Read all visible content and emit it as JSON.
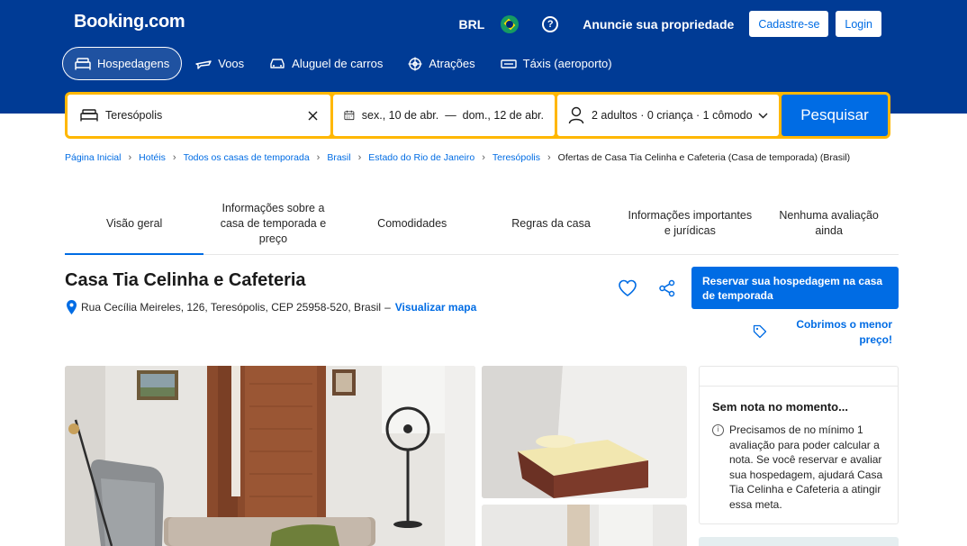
{
  "header": {
    "logo": "Booking.com",
    "currency": "BRL",
    "list_property": "Anuncie sua propriedade",
    "register": "Cadastre-se",
    "login": "Login",
    "flag_icon": "brazil-flag-icon",
    "help_icon": "help-icon"
  },
  "nav": {
    "items": [
      {
        "label": "Hospedagens",
        "icon": "bed-icon",
        "active": true
      },
      {
        "label": "Voos",
        "icon": "plane-icon"
      },
      {
        "label": "Aluguel de carros",
        "icon": "car-icon"
      },
      {
        "label": "Atrações",
        "icon": "attractions-icon"
      },
      {
        "label": "Táxis (aeroporto)",
        "icon": "taxi-icon"
      }
    ]
  },
  "search": {
    "destination": "Teresópolis",
    "dates": "sex., 10 de abr.  —  dom., 12 de abr.",
    "guests": "2 adultos · 0 criança · 1 cômodo",
    "button": "Pesquisar"
  },
  "breadcrumb": [
    "Página Inicial",
    "Hotéis",
    "Todos os casas de temporada",
    "Brasil",
    "Estado do Rio de Janeiro",
    "Teresópolis"
  ],
  "breadcrumb_current": "Ofertas de Casa Tia Celinha e Cafeteria (Casa de temporada) (Brasil)",
  "tabs": [
    "Visão geral",
    "Informações sobre a casa de temporada e preço",
    "Comodidades",
    "Regras da casa",
    "Informações importantes e jurídicas",
    "Nenhuma avaliação ainda"
  ],
  "property": {
    "name": "Casa Tia Celinha e Cafeteria",
    "address": "Rua Cecília Meireles, 126, Teresópolis, CEP 25958-520, Brasil",
    "address_sep": "–",
    "map_link": "Visualizar mapa",
    "reserve_button": "Reservar sua hospedagem na casa de temporada",
    "lowest_price": "Cobrimos o menor preço!"
  },
  "score": {
    "title": "Sem nota no momento...",
    "text": "Precisamos de no mínimo 1 avaliação para poder calcular a nota. Se você reservar e avaliar sua hospedagem, ajudará Casa Tia Celinha e Cafeteria a atingir essa meta."
  },
  "colors": {
    "brand_blue": "#003b95",
    "accent_blue": "#006ce4",
    "search_border": "#ffb700"
  }
}
